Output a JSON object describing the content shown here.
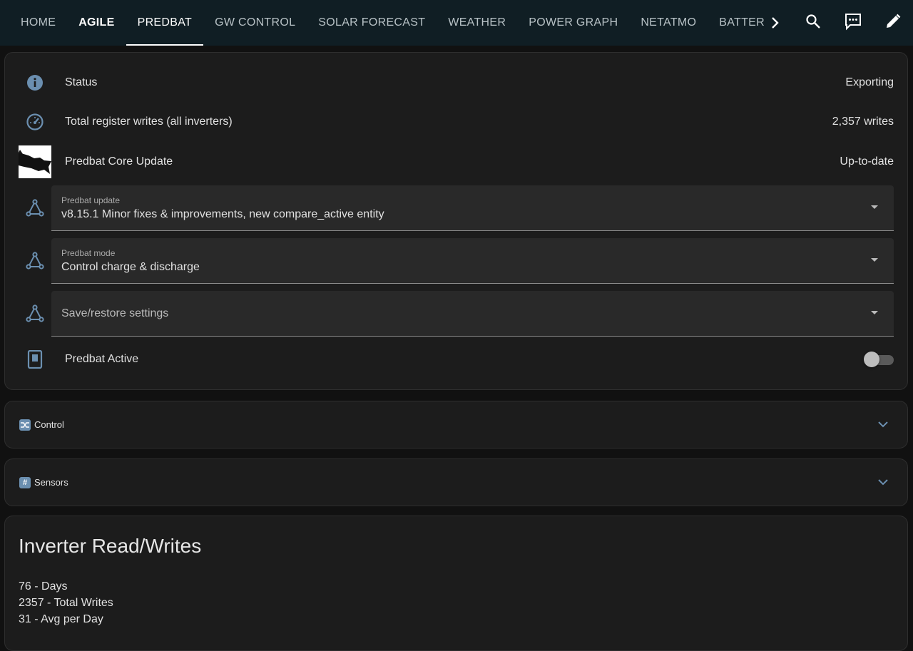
{
  "nav": {
    "tabs": [
      {
        "label": "HOME"
      },
      {
        "label": "AGILE"
      },
      {
        "label": "PREDBAT"
      },
      {
        "label": "GW CONTROL"
      },
      {
        "label": "SOLAR FORECAST"
      },
      {
        "label": "WEATHER"
      },
      {
        "label": "POWER GRAPH"
      },
      {
        "label": "NETATMO"
      },
      {
        "label": "BATTERY TEMPERATURE"
      }
    ],
    "active_tab": "PREDBAT",
    "icons": [
      "chevron-right-icon",
      "search-icon",
      "assist-message-icon",
      "edit-pencil-icon"
    ]
  },
  "entities": {
    "status": {
      "label": "Status",
      "value": "Exporting",
      "icon": "information-icon"
    },
    "writes": {
      "label": "Total register writes (all inverters)",
      "value": "2,357 writes",
      "icon": "gauge-icon"
    },
    "core_update": {
      "label": "Predbat Core Update",
      "value": "Up-to-date",
      "icon": "bat-picture"
    },
    "update_select": {
      "label": "Predbat update",
      "value": "v8.15.1 Minor fixes & improvements, new compare_active entity",
      "icon": "select-graph-icon"
    },
    "mode_select": {
      "label": "Predbat mode",
      "value": "Control charge & discharge",
      "icon": "select-graph-icon"
    },
    "save_select": {
      "placeholder": "Save/restore settings",
      "icon": "select-graph-icon"
    },
    "active": {
      "label": "Predbat Active",
      "state": false,
      "icon": "switch-device-icon"
    }
  },
  "folds": {
    "control": {
      "title": "Control",
      "icon": "shuffle-icon"
    },
    "sensors": {
      "title": "Sensors",
      "icon": "hash-icon"
    }
  },
  "markdown": {
    "title": "Inverter Read/Writes",
    "lines": [
      "76 - Days",
      "2357 - Total Writes",
      "31 - Avg per Day"
    ]
  },
  "colors": {
    "header_bg": "#101e24",
    "card_bg": "#1c1c1c",
    "icon_blue": "#6b8fb0"
  }
}
